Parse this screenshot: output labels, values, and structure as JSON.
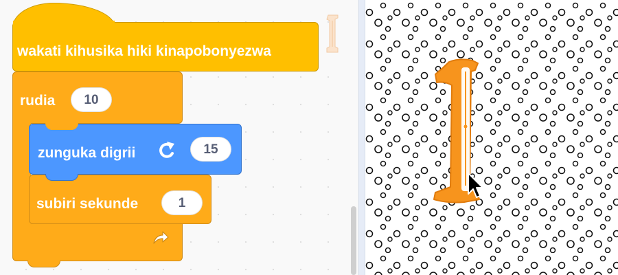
{
  "code_area": {
    "hat_block": {
      "label": "wakati kihusika hiki kinapobonyezwa"
    },
    "repeat_block": {
      "label": "rudia",
      "times": "10",
      "loop_arrow": "loop-arrow-icon"
    },
    "turn_block": {
      "label": "zunguka digrii",
      "degrees": "15",
      "direction_icon": "rotate-right-icon"
    },
    "wait_block": {
      "label": "subiri sekunde",
      "seconds": "1"
    }
  },
  "colors": {
    "events": "#ffbf00",
    "control": "#ffab19",
    "motion": "#4c97ff",
    "sprite": "#f7941d"
  },
  "stage": {
    "backdrop": "polka-dot-circles",
    "sprite": "letter-I-sprite",
    "cursor": "mouse-pointer-icon"
  }
}
